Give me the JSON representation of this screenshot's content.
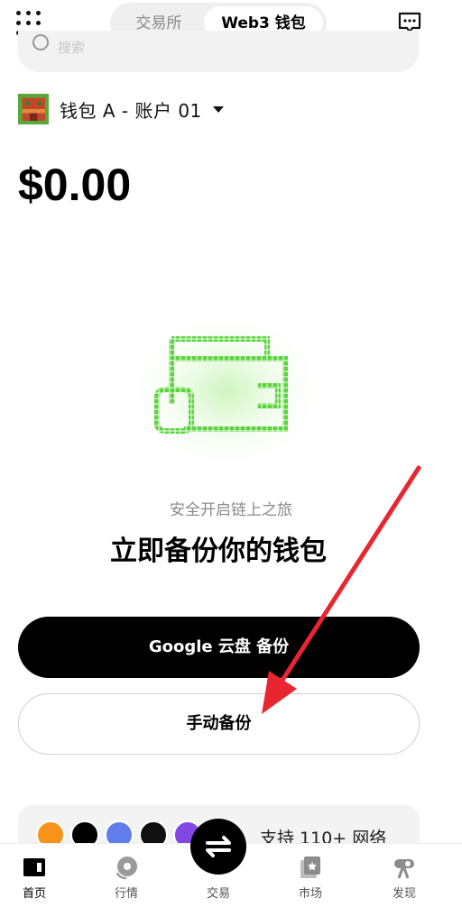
{
  "header": {
    "tabs": [
      {
        "label": "交易所",
        "active": false
      },
      {
        "label": "Web3 钱包",
        "active": true
      }
    ],
    "menu_icon": "grid-dots-icon",
    "message_icon": "chat-bubble-icon"
  },
  "search": {
    "placeholder": "搜索"
  },
  "account": {
    "name": "钱包 A - 账户 01"
  },
  "balance": "$0.00",
  "backup": {
    "subtitle": "安全开启链上之旅",
    "headline": "立即备份你的钱包",
    "google_button": "Google 云盘 备份",
    "manual_button": "手动备份"
  },
  "networks": {
    "text": "支持 110+ 网络",
    "coins": [
      {
        "icon": "bitcoin-icon",
        "color": "#f7931a"
      },
      {
        "icon": "okx-icon",
        "color": "#000000"
      },
      {
        "icon": "ethereum-icon",
        "color": "#627eea"
      },
      {
        "icon": "leap-icon",
        "color": "#111111"
      },
      {
        "icon": "polygon-icon",
        "color": "#8247e5"
      }
    ]
  },
  "bottom_nav": [
    {
      "label": "首页",
      "icon": "wallet-icon",
      "active": true
    },
    {
      "label": "行情",
      "icon": "chart-icon",
      "active": false
    },
    {
      "label": "交易",
      "icon": "swap-icon",
      "active": false
    },
    {
      "label": "市场",
      "icon": "market-icon",
      "active": false
    },
    {
      "label": "发现",
      "icon": "telescope-icon",
      "active": false
    }
  ],
  "colors": {
    "primary": "#000000",
    "accent_green": "#5cd43f",
    "annotation_red": "#e8262f"
  }
}
